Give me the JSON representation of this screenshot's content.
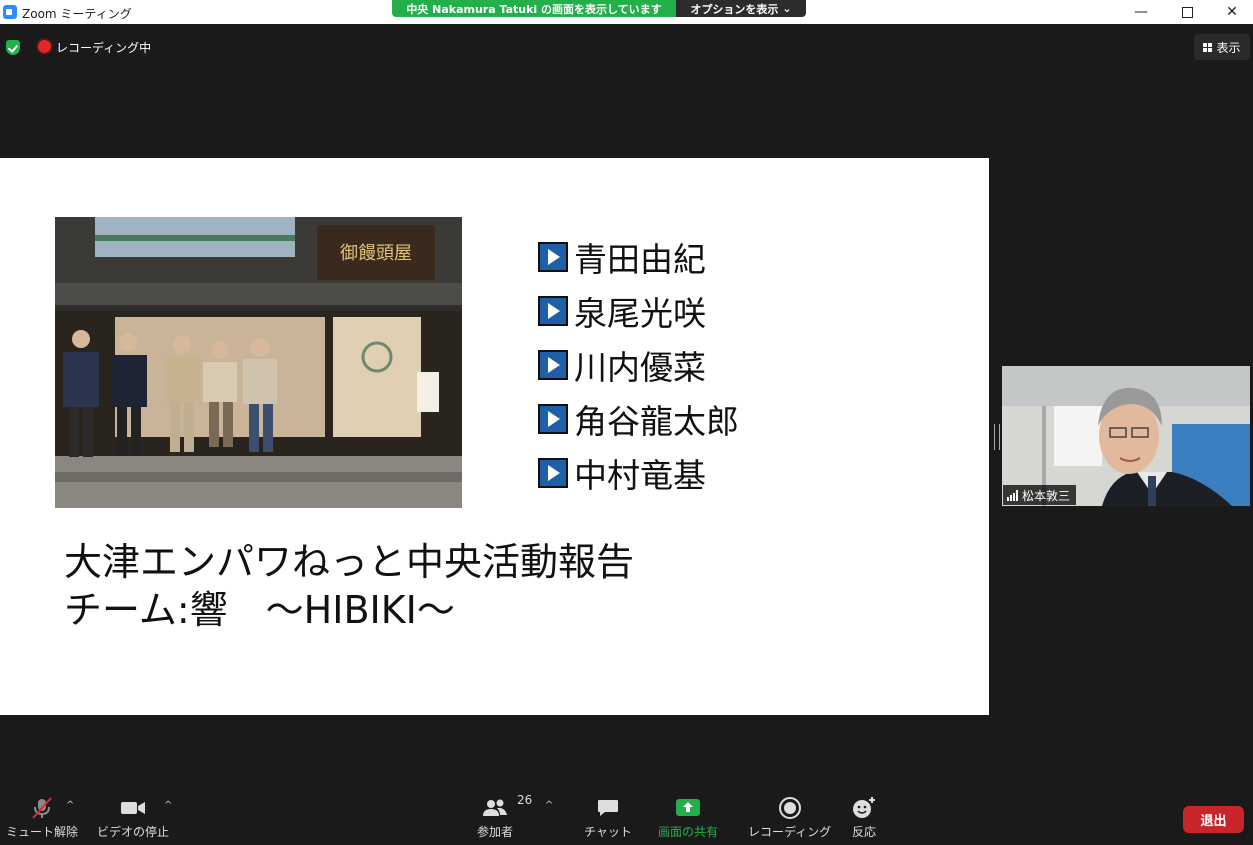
{
  "window": {
    "title": "Zoom ミーティング",
    "controls": [
      "minimize",
      "maximize",
      "close"
    ]
  },
  "share_banner": {
    "text": "中央 Nakamura Tatuki の画面を表示しています",
    "options_label": "オプションを表示"
  },
  "status": {
    "recording_label": "レコーディング中",
    "view_label": "表示"
  },
  "slide": {
    "names": [
      "青田由紀",
      "泉尾光咲",
      "川内優菜",
      "角谷龍太郎",
      "中村竜基"
    ],
    "title_line1": "大津エンパワねっと中央活動報告",
    "title_line2": "チーム:響　～HIBIKI～"
  },
  "participant_video": {
    "name": "松本敦三"
  },
  "toolbar": {
    "mute_label": "ミュート解除",
    "video_label": "ビデオの停止",
    "participants_label": "参加者",
    "participants_count": "26",
    "chat_label": "チャット",
    "share_label": "画面の共有",
    "record_label": "レコーディング",
    "reactions_label": "反応",
    "leave_label": "退出"
  },
  "colors": {
    "share_green": "#23b04b",
    "leave_red": "#c8262b",
    "play_blue": "#1e5fa8"
  }
}
